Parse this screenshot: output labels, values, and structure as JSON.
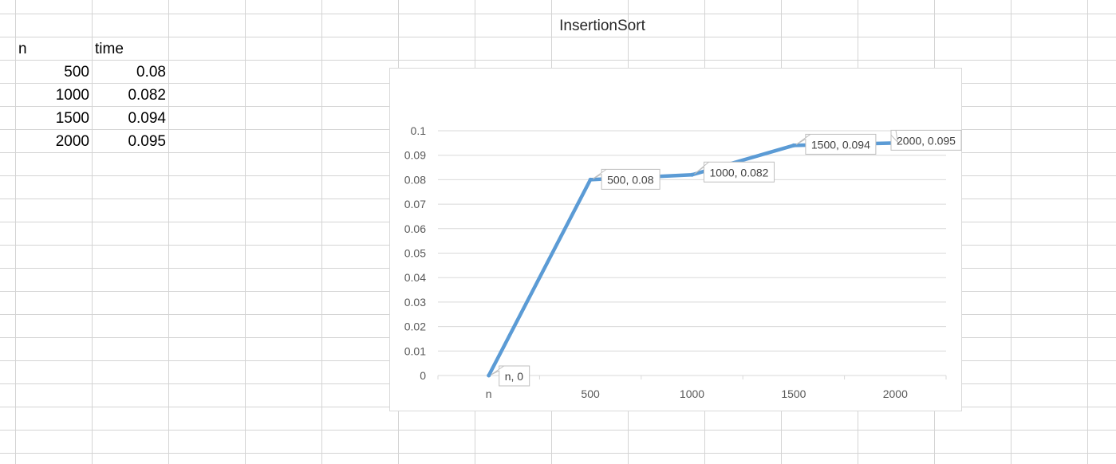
{
  "sheet": {
    "header_n": "n",
    "header_time": "time",
    "rows": [
      {
        "n": "500",
        "time": "0.08"
      },
      {
        "n": "1000",
        "time": "0.082"
      },
      {
        "n": "1500",
        "time": "0.094"
      },
      {
        "n": "2000",
        "time": "0.095"
      }
    ]
  },
  "chart_data": {
    "type": "line",
    "title": "InsertionSort",
    "categories": [
      "n",
      "500",
      "1000",
      "1500",
      "2000"
    ],
    "series": [
      {
        "values": [
          0,
          0.08,
          0.082,
          0.094,
          0.095
        ],
        "color": "#5b9bd5"
      }
    ],
    "data_labels": [
      "n, 0",
      "500, 0.08",
      "1000, 0.082",
      "1500, 0.094",
      "2000, 0.095"
    ],
    "y_ticks": [
      "0",
      "0.01",
      "0.02",
      "0.03",
      "0.04",
      "0.05",
      "0.06",
      "0.07",
      "0.08",
      "0.09",
      "0.1"
    ],
    "ylim": [
      0,
      0.1
    ],
    "grid": true,
    "legend": "none"
  },
  "colors": {
    "gridline": "#d4d4d4",
    "chart_gridline": "#d9d9d9",
    "line": "#5b9bd5"
  }
}
